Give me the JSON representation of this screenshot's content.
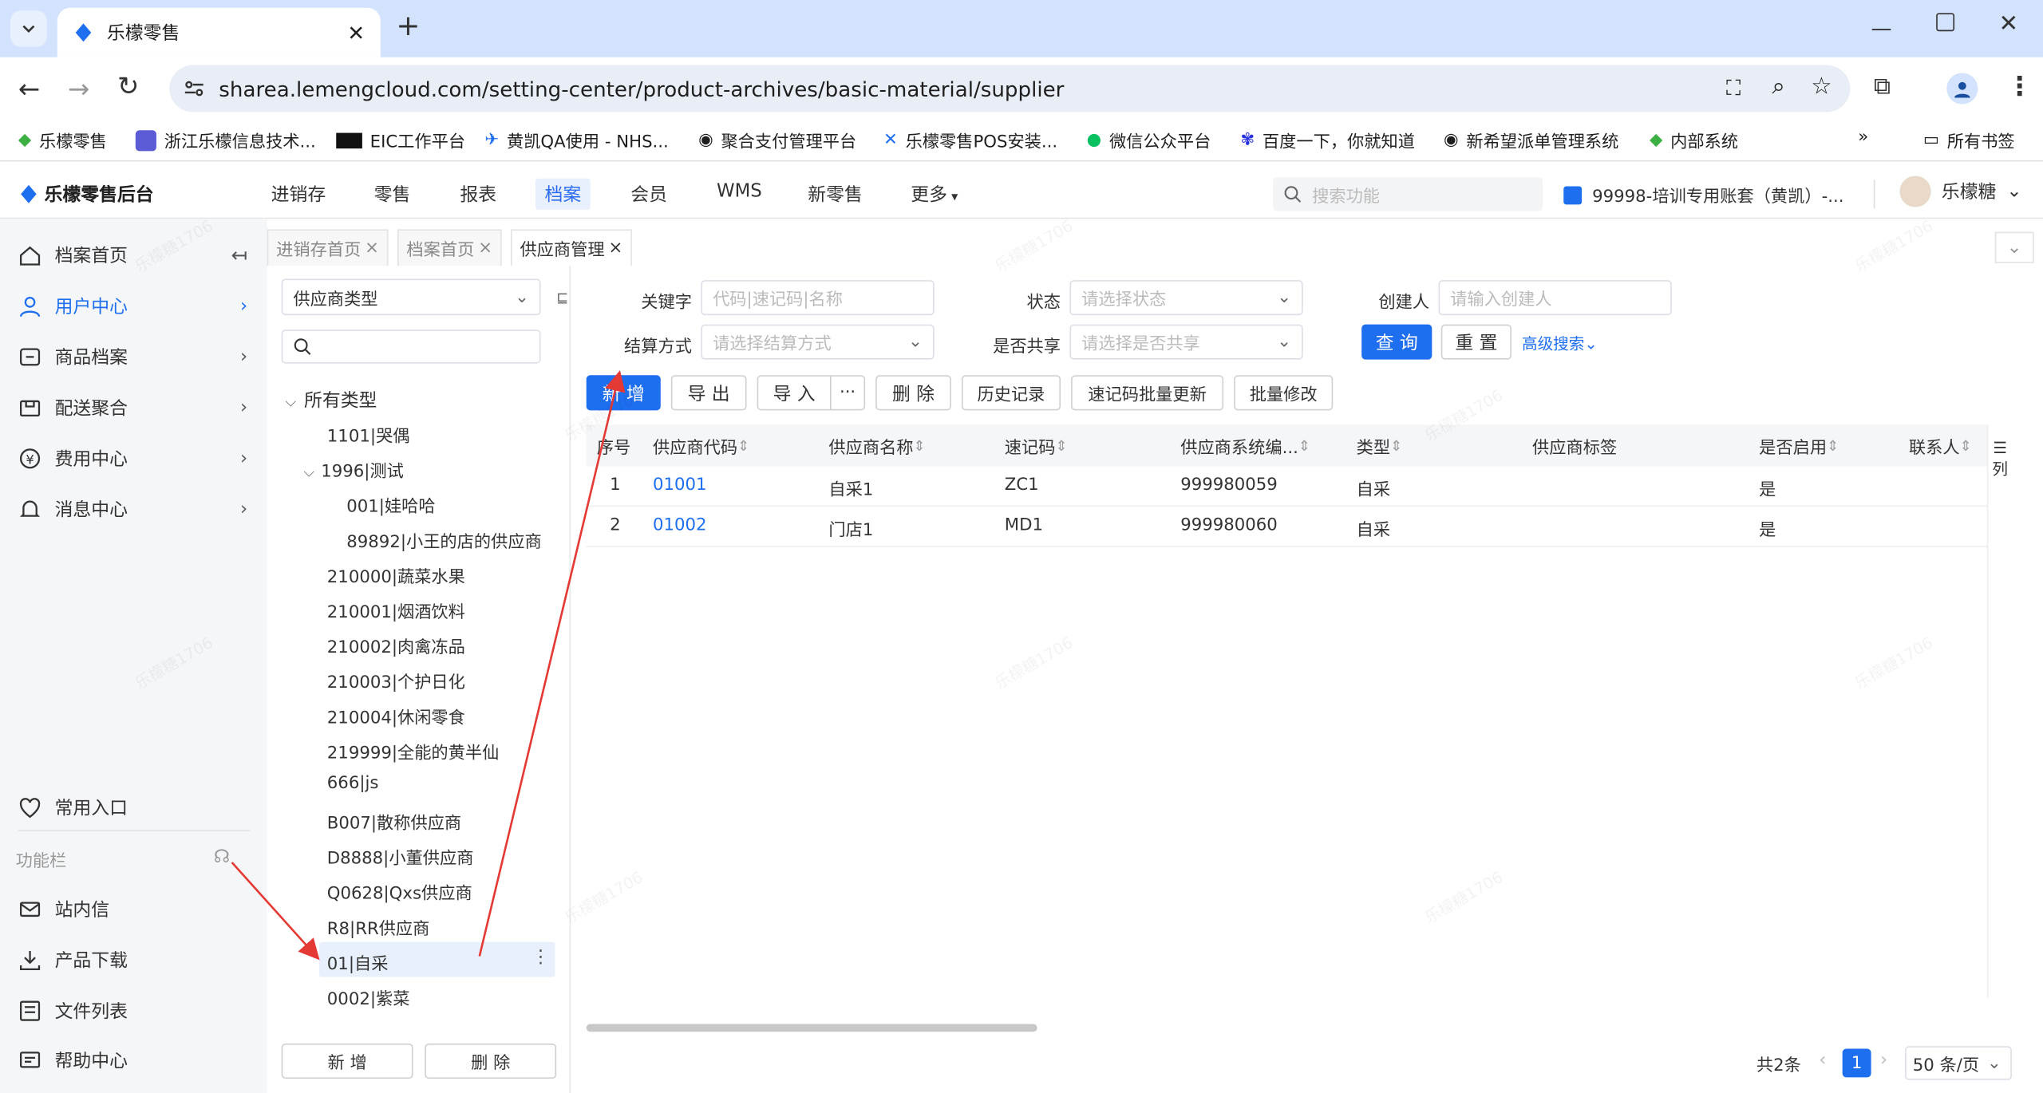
{
  "browser": {
    "tab_title": "乐檬零售",
    "new_tab_label": "+",
    "url": "sharea.lemengcloud.com/setting-center/product-archives/basic-material/supplier",
    "bookmarks": [
      "乐檬零售",
      "浙江乐檬信息技术...",
      "EIC工作平台",
      "黄凯QA使用 - NHS...",
      "聚合支付管理平台",
      "乐檬零售POS安装...",
      "微信公众平台",
      "百度一下，你就知道",
      "新希望派单管理系统",
      "内部系统"
    ],
    "all_bookmarks": "所有书签",
    "more": "»"
  },
  "app": {
    "logo_text": "乐檬零售后台",
    "nav": [
      "进销存",
      "零售",
      "报表",
      "档案",
      "会员",
      "WMS",
      "新零售",
      "更多"
    ],
    "search_placeholder": "搜索功能",
    "account": "99998-培训专用账套（黄凯）-...",
    "user": "乐檬糖"
  },
  "sidebar": {
    "items": [
      {
        "label": "档案首页",
        "icon": "home-icon"
      },
      {
        "label": "用户中心",
        "icon": "user-icon"
      },
      {
        "label": "商品档案",
        "icon": "box-icon"
      },
      {
        "label": "配送聚合",
        "icon": "truck-icon"
      },
      {
        "label": "费用中心",
        "icon": "yen-icon"
      },
      {
        "label": "消息中心",
        "icon": "bell-icon"
      }
    ],
    "favorites": "常用入口",
    "func_title": "功能栏",
    "bottom": [
      {
        "label": "站内信",
        "icon": "mail-icon"
      },
      {
        "label": "产品下载",
        "icon": "download-icon"
      },
      {
        "label": "文件列表",
        "icon": "list-icon"
      },
      {
        "label": "帮助中心",
        "icon": "help-icon"
      }
    ]
  },
  "page_tabs": [
    "进销存首页",
    "档案首页",
    "供应商管理"
  ],
  "tree": {
    "type_select": "供应商类型",
    "root": "所有类型",
    "nodes": [
      "1101|哭偶",
      "1996|测试",
      "001|娃哈哈",
      "89892|小王的店的供应商",
      "210000|蔬菜水果",
      "210001|烟酒饮料",
      "210002|肉禽冻品",
      "210003|个护日化",
      "210004|休闲零食",
      "219999|全能的黄半仙",
      "666|js",
      "B007|散称供应商",
      "D8888|小董供应商",
      "Q0628|Qxs供应商",
      "R8|RR供应商",
      "01|自采",
      "0002|紫菜"
    ],
    "add": "新 增",
    "delete": "删 除"
  },
  "filters": {
    "keyword_label": "关键字",
    "keyword_ph": "代码|速记码|名称",
    "status_label": "状态",
    "status_ph": "请选择状态",
    "creator_label": "创建人",
    "creator_ph": "请输入创建人",
    "settle_label": "结算方式",
    "settle_ph": "请选择结算方式",
    "share_label": "是否共享",
    "share_ph": "请选择是否共享",
    "query": "查 询",
    "reset": "重 置",
    "advanced": "高级搜索"
  },
  "toolbar": [
    "新 增",
    "导 出",
    "导 入",
    "···",
    "删 除",
    "历史记录",
    "速记码批量更新",
    "批量修改"
  ],
  "table": {
    "headers": [
      "序号",
      "供应商代码",
      "供应商名称",
      "速记码",
      "供应商系统编...",
      "类型",
      "供应商标签",
      "是否启用",
      "联系人"
    ],
    "rows": [
      [
        "1",
        "01001",
        "自采1",
        "ZC1",
        "999980059",
        "自采",
        "",
        "是",
        ""
      ],
      [
        "2",
        "01002",
        "门店1",
        "MD1",
        "999980060",
        "自采",
        "",
        "是",
        ""
      ]
    ],
    "col_setting": "列"
  },
  "pagination": {
    "total": "共2条",
    "current": "1",
    "size": "50 条/页"
  },
  "watermark": "乐檬糖1706"
}
